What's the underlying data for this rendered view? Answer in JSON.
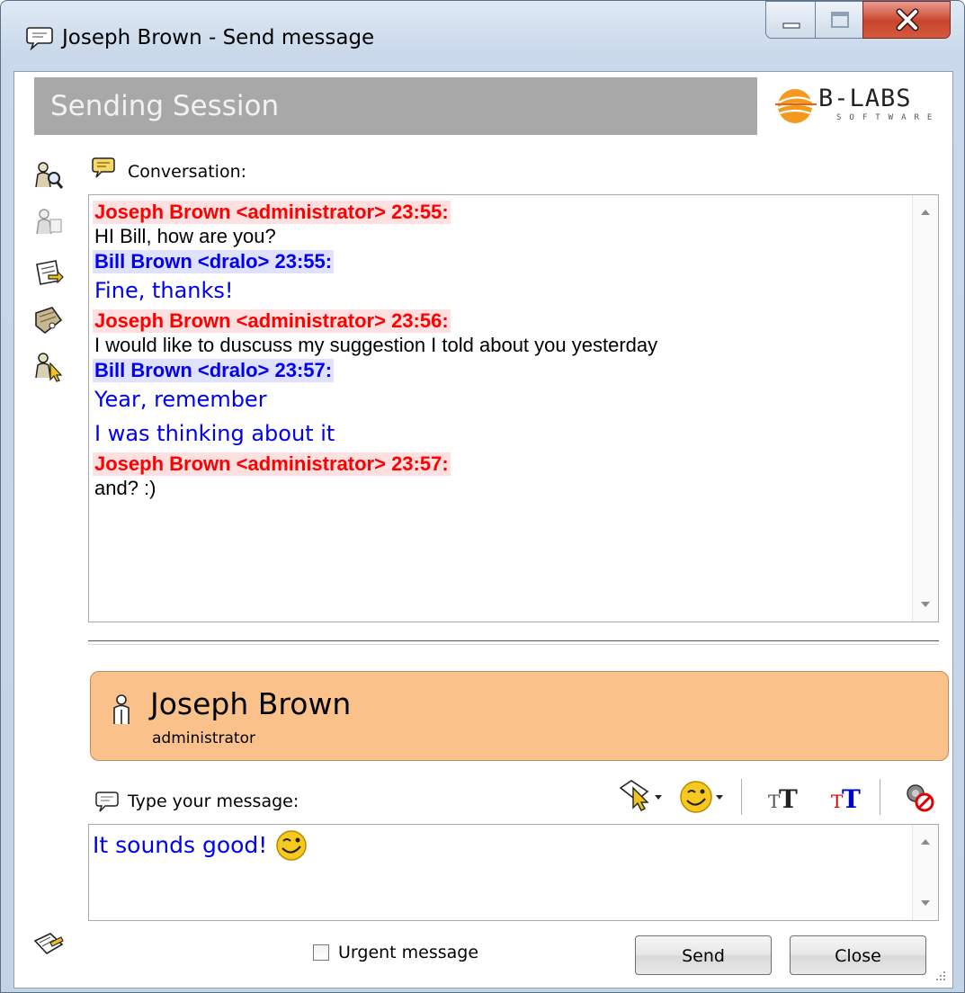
{
  "window": {
    "title": "Joseph Brown - Send message"
  },
  "header": {
    "title": "Sending Session",
    "logo_text": "B-LABS",
    "logo_sub": "SOFTWARE"
  },
  "conversation": {
    "label": "Conversation:",
    "messages": [
      {
        "sender": "Joseph Brown <administrator> 23:55:",
        "lines": [
          "HI Bill, how are you?"
        ]
      },
      {
        "sender": "Bill Brown <dralo> 23:55:",
        "lines": [
          "Fine, thanks!"
        ]
      },
      {
        "sender": "Joseph Brown <administrator> 23:56:",
        "lines": [
          "I would like to duscuss my suggestion I told about you yesterday"
        ]
      },
      {
        "sender": "Bill Brown <dralo> 23:57:",
        "lines": [
          "Year, remember",
          "I was thinking about it"
        ]
      },
      {
        "sender": "Joseph Brown <administrator> 23:57:",
        "lines": [
          "and? :)"
        ]
      }
    ]
  },
  "recipient": {
    "name": "Joseph Brown",
    "role": "administrator"
  },
  "compose": {
    "label": "Type your message:",
    "text": "It sounds good!"
  },
  "footer": {
    "urgent_label": "Urgent message",
    "urgent_checked": false,
    "send_label": "Send",
    "close_label": "Close"
  },
  "colors": {
    "own_sender": "#ff0000",
    "own_sender_bg": "#ffe0e0",
    "other_sender": "#0000ee",
    "other_sender_bg": "#e0e0ff",
    "card_bg": "#fac28a",
    "header_bar": "#a8a8a8"
  },
  "icons": {
    "sidebar": [
      "search-user-icon",
      "user-gray-icon",
      "note-arrow-icon",
      "tag-icon",
      "user-pointer-icon",
      "notes-icon"
    ],
    "toolbar": [
      "pointer-dropdown-icon",
      "smiley-dropdown-icon",
      "font-icon",
      "font-color-icon",
      "block-icon"
    ]
  }
}
